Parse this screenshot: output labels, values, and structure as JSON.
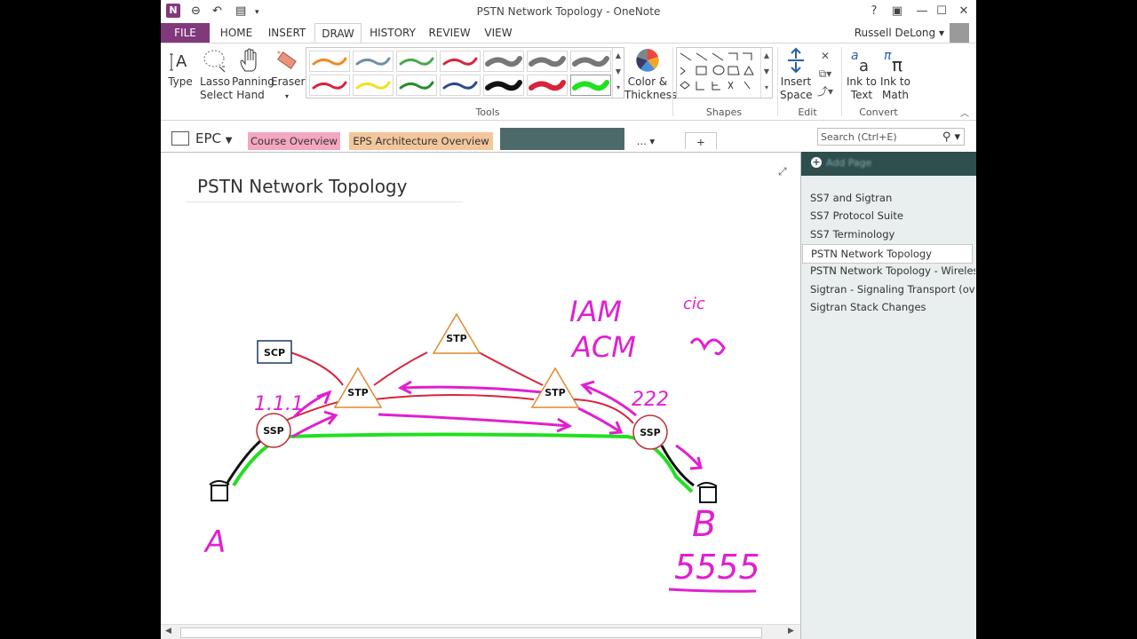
{
  "window": {
    "title": "PSTN Network Topology - OneNote"
  },
  "titlebar": {
    "help": "?",
    "user": "Russell DeLong"
  },
  "ribbon_tabs": [
    "FILE",
    "HOME",
    "INSERT",
    "DRAW",
    "HISTORY",
    "REVIEW",
    "VIEW"
  ],
  "active_tab": "DRAW",
  "ribbon": {
    "type_label": "Type",
    "lasso_label_1": "Lasso",
    "lasso_label_2": "Select",
    "panning_label_1": "Panning",
    "panning_label_2": "Hand",
    "eraser_label": "Eraser",
    "color_label_1": "Color &",
    "color_label_2": "Thickness",
    "insert_space_1": "Insert",
    "insert_space_2": "Space",
    "ink_text_1": "Ink to",
    "ink_text_2": "Text",
    "ink_math_1": "Ink to",
    "ink_math_2": "Math",
    "groups": {
      "tools": "Tools",
      "shapes": "Shapes",
      "edit": "Edit",
      "convert": "Convert"
    },
    "pen_colors": [
      "#f08a24",
      "#6e8fa8",
      "#4aa84a",
      "#d8243c",
      "#777777",
      "#777777",
      "#777777",
      "#d8243c",
      "#f0e020",
      "#2a8a2a",
      "#2a4a8a",
      "#111111",
      "#d8243c",
      "#20e020"
    ]
  },
  "notebook": {
    "name": "EPC",
    "sections": [
      {
        "label": "Course Overview",
        "color": "#f4a7c0"
      },
      {
        "label": "EPS Architecture Overview",
        "color": "#f3c69b"
      },
      {
        "label": "",
        "color": "#4c6a6a"
      }
    ],
    "more": "...",
    "add": "+"
  },
  "search": {
    "placeholder": "Search (Ctrl+E)"
  },
  "page": {
    "title": "PSTN Network Topology",
    "nodes": {
      "scp": "SCP",
      "stp": "STP",
      "ssp": "SSP"
    },
    "ink": {
      "left_addr": "1.1.1",
      "right_addr": "222",
      "iam": "IAM",
      "acm": "ACM",
      "cic": "cic",
      "a": "A",
      "b": "B",
      "number": "5555"
    }
  },
  "pages": [
    "SS7 and Sigtran",
    "SS7 Protocol Suite",
    "SS7 Terminology",
    "PSTN Network Topology",
    "PSTN Network Topology - Wireles",
    "Sigtran - Signaling Transport (ove",
    "Sigtran Stack Changes"
  ],
  "selected_page": "PSTN Network Topology"
}
